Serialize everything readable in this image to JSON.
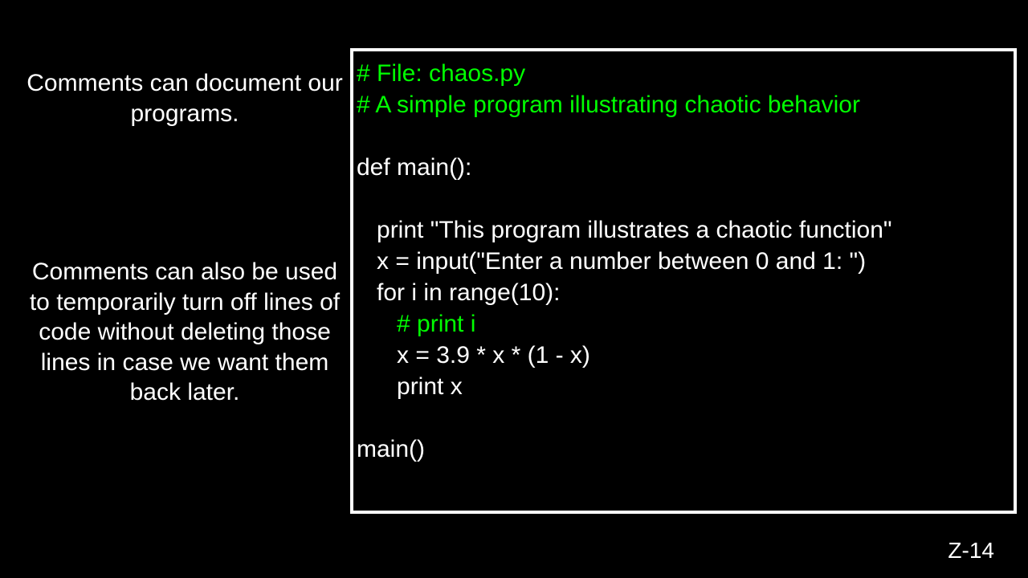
{
  "captions": {
    "caption1": "Comments can document our programs.",
    "caption2": "Comments can also be used to temporarily turn off lines of code without deleting those lines in case we want them back later."
  },
  "code": {
    "line1": "# File: chaos.py",
    "line2": "# A simple program illustrating chaotic behavior",
    "line3": "def main():",
    "line4": "   print \"This program illustrates a chaotic function\"",
    "line5": "   x = input(\"Enter a number between 0 and 1: \")",
    "line6": "   for i in range(10):",
    "line7": "      # print i",
    "line8": "      x = 3.9 * x * (1 - x)",
    "line9": "      print x",
    "line10": "main()"
  },
  "slideNumber": "Z-14"
}
